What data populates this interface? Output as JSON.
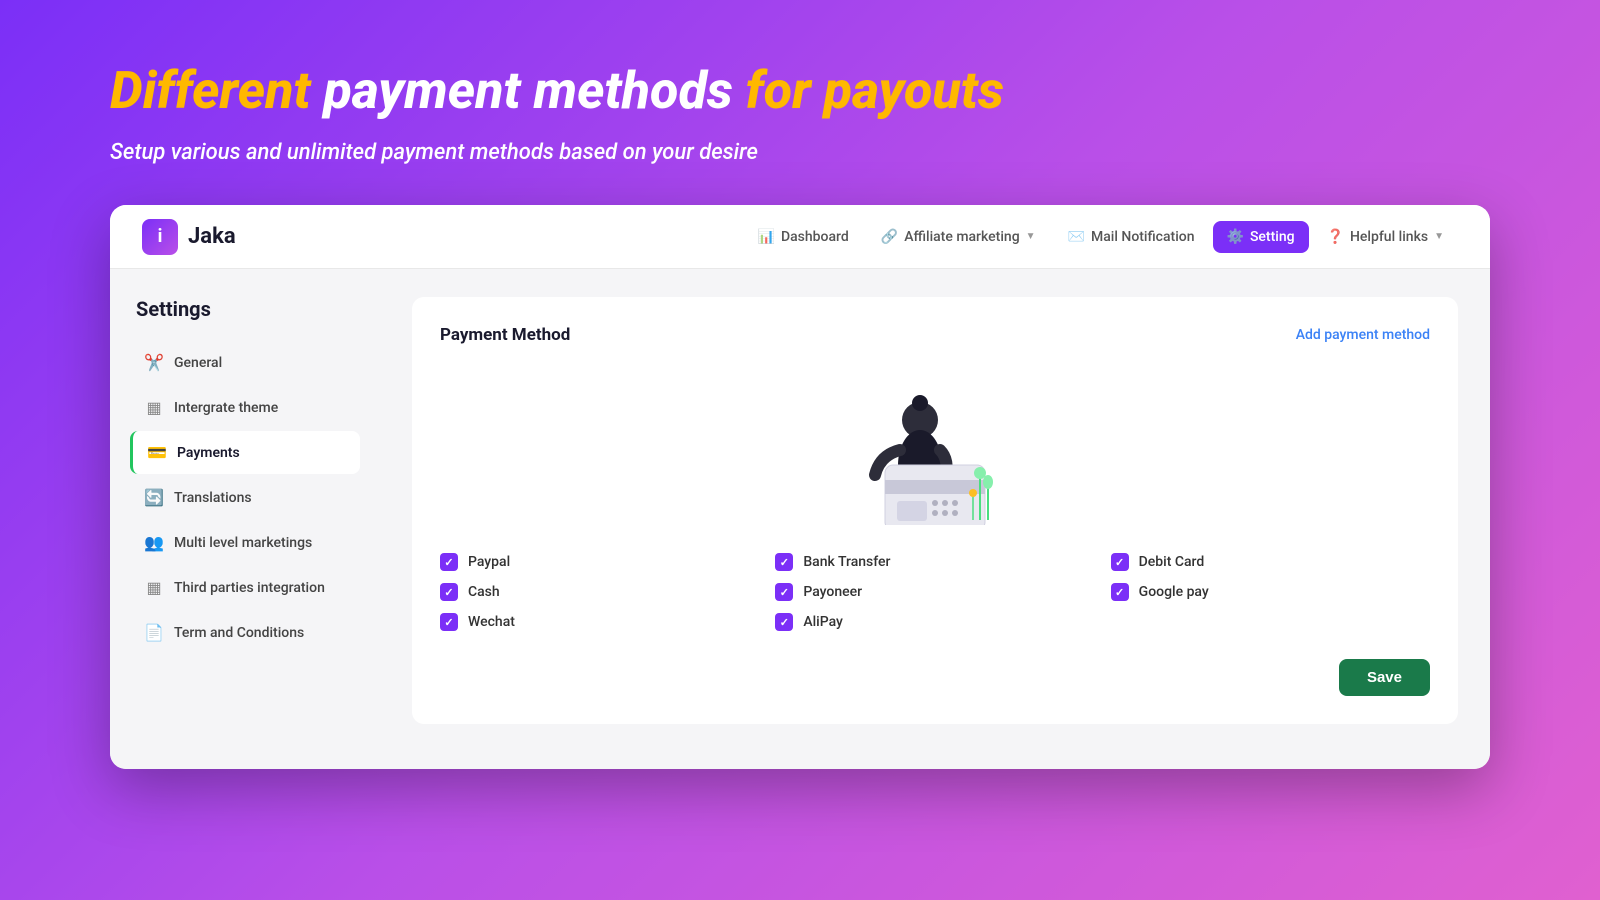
{
  "hero": {
    "title_part1": "Different",
    "title_part2": "payment methods",
    "title_part3": "for payouts",
    "subtitle": "Setup various and unlimited payment methods based on your desire"
  },
  "app": {
    "logo_text": "Jaka",
    "logo_letter": "i"
  },
  "nav": {
    "items": [
      {
        "id": "dashboard",
        "label": "Dashboard",
        "icon": "📊",
        "active": false,
        "dropdown": false
      },
      {
        "id": "affiliate",
        "label": "Affiliate marketing",
        "icon": "🔗",
        "active": false,
        "dropdown": true
      },
      {
        "id": "mail",
        "label": "Mail Notification",
        "icon": "✉️",
        "active": false,
        "dropdown": false
      },
      {
        "id": "setting",
        "label": "Setting",
        "icon": "⚙️",
        "active": true,
        "dropdown": false
      },
      {
        "id": "helpful",
        "label": "Helpful links",
        "icon": "❓",
        "active": false,
        "dropdown": true
      }
    ]
  },
  "sidebar": {
    "title": "Settings",
    "items": [
      {
        "id": "general",
        "label": "General",
        "icon": "✂️",
        "active": false
      },
      {
        "id": "integrate",
        "label": "Intergrate theme",
        "icon": "▦",
        "active": false
      },
      {
        "id": "payments",
        "label": "Payments",
        "icon": "💳",
        "active": true
      },
      {
        "id": "translations",
        "label": "Translations",
        "icon": "🔄",
        "active": false
      },
      {
        "id": "multi-level",
        "label": "Multi level marketings",
        "icon": "👥",
        "active": false
      },
      {
        "id": "third-parties",
        "label": "Third parties integration",
        "icon": "▦",
        "active": false
      },
      {
        "id": "terms",
        "label": "Term and Conditions",
        "icon": "📄",
        "active": false
      }
    ]
  },
  "payment_section": {
    "title": "Payment Method",
    "add_link": "Add payment method",
    "methods": [
      {
        "id": "paypal",
        "label": "Paypal",
        "checked": true
      },
      {
        "id": "bank-transfer",
        "label": "Bank Transfer",
        "checked": true
      },
      {
        "id": "debit-card",
        "label": "Debit Card",
        "checked": true
      },
      {
        "id": "cash",
        "label": "Cash",
        "checked": true
      },
      {
        "id": "payoneer",
        "label": "Payoneer",
        "checked": true
      },
      {
        "id": "google-pay",
        "label": "Google pay",
        "checked": true
      },
      {
        "id": "wechat",
        "label": "Wechat",
        "checked": true
      },
      {
        "id": "alipay",
        "label": "AliPay",
        "checked": true
      }
    ],
    "save_button": "Save"
  }
}
